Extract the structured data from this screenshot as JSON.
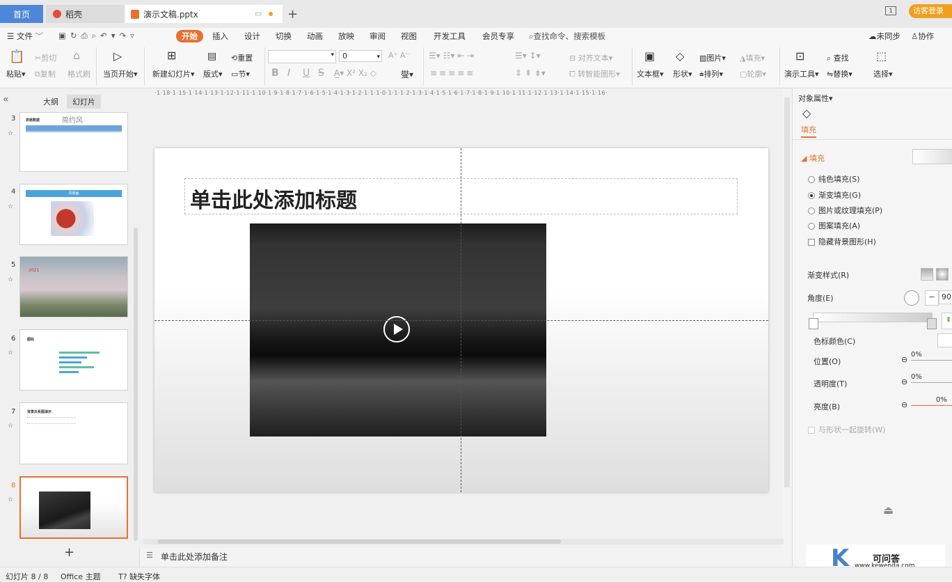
{
  "tabs": {
    "home": "首页",
    "daoke": "稻壳",
    "doc": "演示文稿.pptx",
    "guest_login": "访客登录"
  },
  "menu": {
    "file": "文件",
    "items": [
      "开始",
      "插入",
      "设计",
      "切换",
      "动画",
      "放映",
      "审阅",
      "视图",
      "开发工具",
      "会员专享"
    ],
    "search": "查找命令、搜索模板",
    "unsync": "未同步",
    "collab": "协作"
  },
  "toolbar": {
    "paste": "粘贴",
    "cut": "剪切",
    "copy": "复制",
    "format_painter": "格式刷",
    "from_current": "当页开始",
    "new_slide": "新建幻灯片",
    "layout": "版式",
    "reset": "重置",
    "section": "节",
    "font_size": "0",
    "align_text": "对齐文本",
    "smart_shape": "转智能图形",
    "textbox": "文本框",
    "shape": "形状",
    "picture": "图片",
    "fill": "填充",
    "arrange": "排列",
    "outline": "轮廓",
    "present_tools": "演示工具",
    "find": "查找",
    "replace": "替换",
    "select": "选择",
    "bold": "B",
    "italic": "I",
    "underline": "U",
    "strike": "S"
  },
  "left_panel": {
    "outline_tab": "大纲",
    "slides_tab": "幻灯片",
    "collapse": "«",
    "add": "+",
    "slides": [
      {
        "num": "3",
        "text": "简约风",
        "small": "表格数据"
      },
      {
        "num": "4",
        "text": "风景画"
      },
      {
        "num": "5",
        "text": "2021"
      },
      {
        "num": "6",
        "text": "图标"
      },
      {
        "num": "7",
        "text": "背景关系图演示"
      },
      {
        "num": "8",
        "text": ""
      }
    ]
  },
  "ruler": "·1·18·1·15·1·14·1·13·1·12·1·11·1·10·1·9·1·8·1·7·1·6·1·5·1·4·1·3·1·2·1·1·1·0·1·1·1·2·1·3·1·4·1·5·1·6·1·7·1·8·1·9·1·10·1·11·1·12·1·13·1·14·1·15·1·16·",
  "slide": {
    "title_placeholder": "单击此处添加标题"
  },
  "notes_placeholder": "单击此处添加备注",
  "right_panel": {
    "header": "对象属性",
    "fill_tab": "填充",
    "fill_section": "填充",
    "options": [
      "纯色填充(S)",
      "渐变填充(G)",
      "图片或纹理填充(P)",
      "图案填充(A)"
    ],
    "hide_bg": "隐藏背景图形(H)",
    "gradient_style": "渐变样式(R)",
    "angle": "角度(E)",
    "angle_value": "90.",
    "stop_color": "色标颜色(C)",
    "position": "位置(O)",
    "transparency": "透明度(T)",
    "brightness": "亮度(B)",
    "pct1": "0%",
    "pct2": "0%",
    "pct3": "0%",
    "rotate_with_shape": "与形状一起旋转(W)"
  },
  "status": {
    "slide_count": "幻灯片 8 / 8",
    "theme": "Office 主题",
    "missing_font": "缺失字体"
  },
  "watermark": {
    "brand": "可问答",
    "url": "www.kewenda.com"
  },
  "colors": {
    "accent": "#e8712f",
    "tab_active": "#ffffff",
    "home_tab": "#4e86d8"
  }
}
